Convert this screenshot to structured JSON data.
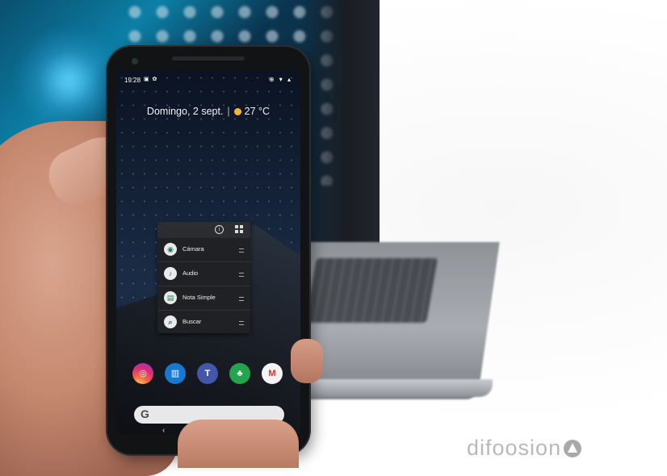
{
  "status_bar": {
    "time": "19:28",
    "left_icons": "▣ ✿",
    "right_icons": "⊕ ▾ ▴"
  },
  "weather_widget": {
    "date": "Domingo, 2 sept.",
    "separator": "|",
    "temperature": "27 °C",
    "icon": "sun-icon"
  },
  "shortcut_popup": {
    "info_icon": "info-icon",
    "widgets_icon": "widgets-icon",
    "items": [
      {
        "label": "Cámara",
        "icon": "camera-icon",
        "glyph": "◉"
      },
      {
        "label": "Audio",
        "icon": "microphone-icon",
        "glyph": "♪"
      },
      {
        "label": "Nota Simple",
        "icon": "note-icon",
        "glyph": "▤"
      },
      {
        "label": "Buscar",
        "icon": "search-icon",
        "glyph": "⌕"
      }
    ]
  },
  "dock": {
    "apps": [
      {
        "name": "instagram-app",
        "glyph": "◎"
      },
      {
        "name": "trello-app",
        "glyph": "▥"
      },
      {
        "name": "teams-app",
        "glyph": "T"
      },
      {
        "name": "evernote-app",
        "glyph": "♣"
      },
      {
        "name": "gmail-app",
        "glyph": "M"
      }
    ]
  },
  "search_bar": {
    "logo": "G"
  },
  "nav_bar": {
    "back_glyph": "‹"
  },
  "watermark": {
    "text": "difoosion"
  },
  "colors": {
    "popup_bg": "#202124",
    "dock_instagram": "#d92d7a",
    "dock_trello": "#1778d2",
    "dock_teams": "#4456a7",
    "dock_evernote": "#24a54d",
    "sun": "#f6b33a"
  }
}
